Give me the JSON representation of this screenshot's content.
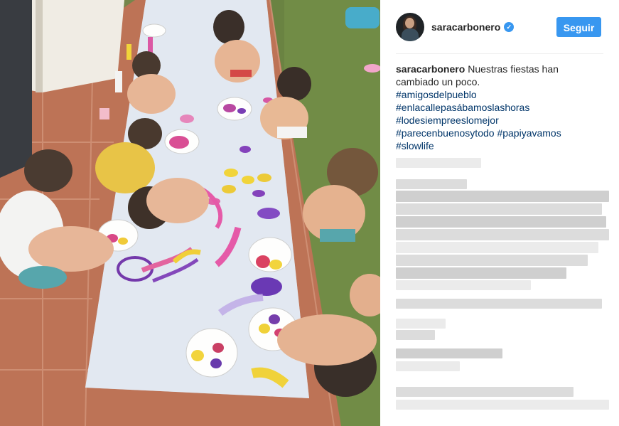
{
  "post": {
    "image_alt": "Niños pintando con las manos sobre papel en el suelo",
    "author": {
      "username": "saracarbonero",
      "verified_icon": "verified-badge-icon"
    },
    "follow_label": "Seguir",
    "caption": {
      "username": "saracarbonero",
      "text": "Nuestras fiestas han cambiado un poco.",
      "hashtags": [
        "#amigosdelpueblo",
        "#enlacallepasábamoslashoras",
        "#lodesiempreeslomejor",
        "#parecenbuenosytodo #papiyavamos",
        "#slowlife"
      ]
    },
    "comments_state": "pixelated",
    "colors": {
      "accent": "#3897f0",
      "hashtag": "#003569",
      "text": "#262626"
    }
  }
}
